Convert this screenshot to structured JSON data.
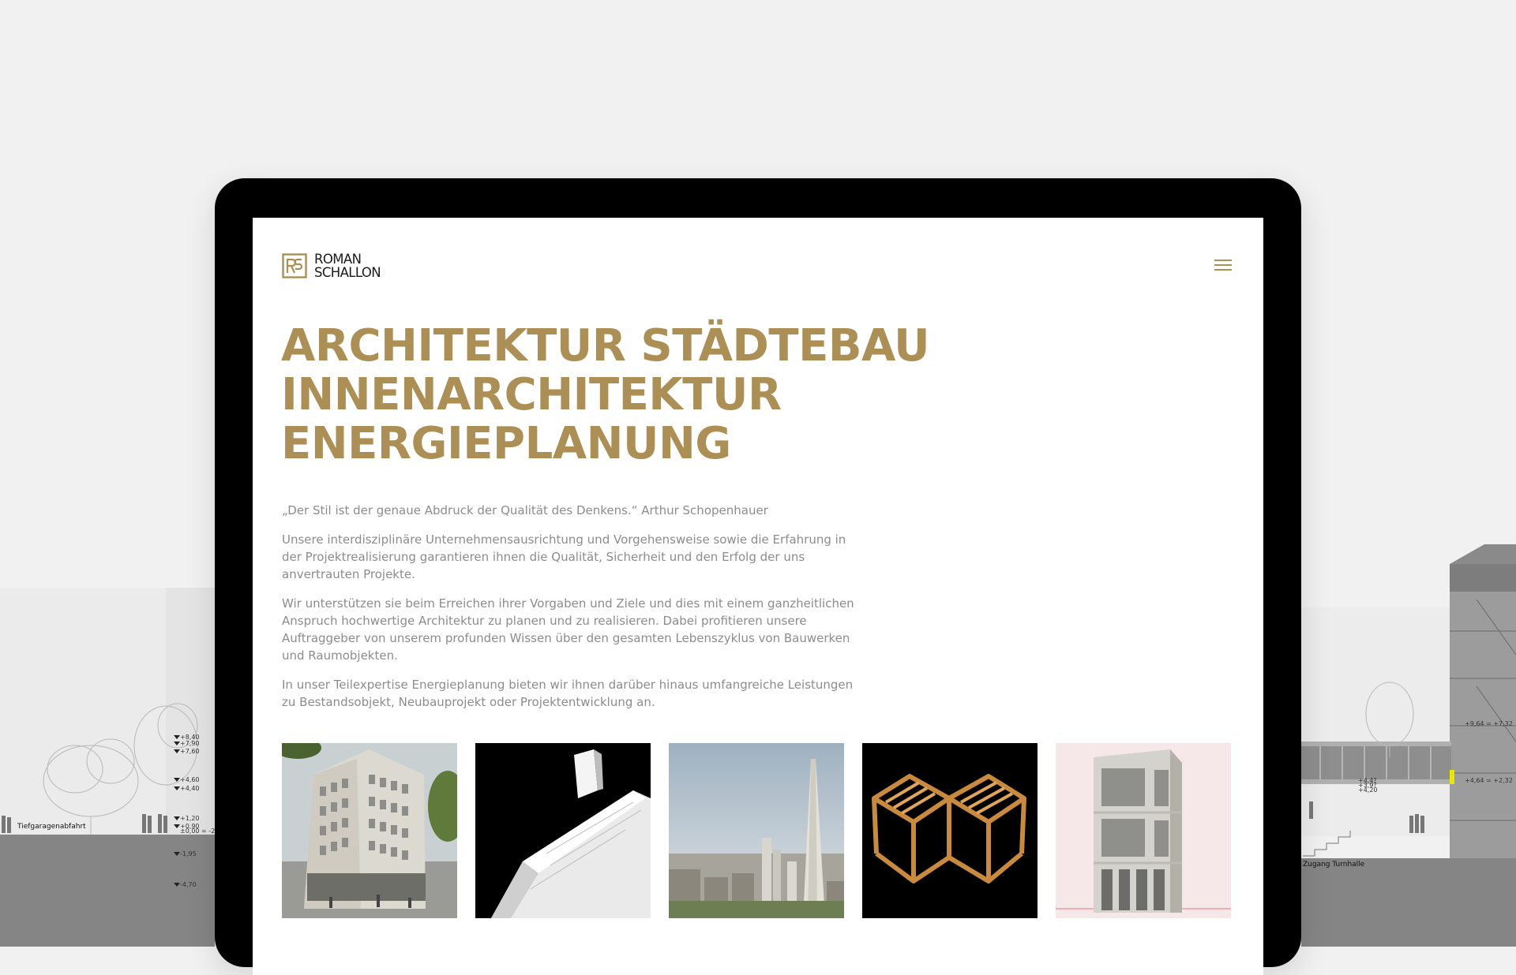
{
  "brand": {
    "name_line1": "ROMAN",
    "name_line2": "SCHALLON",
    "accent_color": "#ab8f55"
  },
  "header": {
    "menu_icon": "hamburger-menu-icon"
  },
  "hero": {
    "lines": [
      "ARCHITEKTUR STÄDTEBAU",
      "INNENARCHITEKTUR",
      "ENERGIEPLANUNG"
    ]
  },
  "intro": {
    "quote": "„Der Stil ist der genaue Abdruck der Qualität des Denkens.“ Arthur Schopenhauer",
    "paragraphs": [
      "Unsere interdisziplinäre Unternehmensausrichtung und Vorgehensweise sowie die Erfahrung in der Projektrealisierung garantieren ihnen die Qualität, Sicherheit und den Erfolg der uns anvertrauten Projekte.",
      "Wir unterstützen sie beim Erreichen ihrer Vorgaben und Ziele und dies mit einem ganzheitlichen Anspruch hochwertige Architektur zu planen und zu realisieren. Dabei profitieren unsere Auftraggeber von unserem profunden Wissen über den gesamten Lebenszyklus von Bauwerken und Raumobjekten.",
      "In unser Teilexpertise Energieplanung bieten wir ihnen darüber hinaus umfangreiche Leistungen zu Bestandsobjekt, Neubauprojekt oder Projektentwicklung an."
    ]
  },
  "background_drawing": {
    "labels": {
      "left_ramp": "Tiefgaragenabfahrt",
      "right_entrance": "Zugang Turnhalle"
    },
    "levels_left": [
      "+8,40",
      "+7,90",
      "+7,60",
      "+4,60",
      "+4,40",
      "+1,20",
      "+0,90",
      "±0,00 = -2,",
      "-1,95",
      "-4,70"
    ],
    "levels_right": [
      "+9,64 = +7,32",
      "+4,64 = +2,32",
      "+4,4?",
      "+3,9?",
      "+4,20"
    ]
  }
}
